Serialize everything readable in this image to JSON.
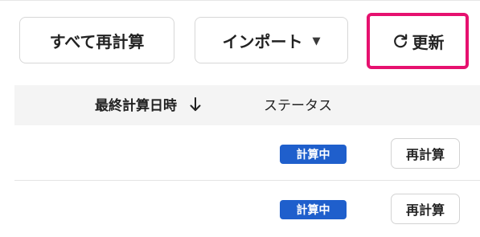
{
  "toolbar": {
    "recalc_all_label": "すべて再計算",
    "import_label": "インポート",
    "refresh_label": "更新",
    "highlight_color": "#e6116f"
  },
  "table": {
    "columns": {
      "last_calculated": "最終計算日時",
      "status": "ステータス"
    },
    "rows": [
      {
        "status": "計算中",
        "action": "再計算"
      },
      {
        "status": "計算中",
        "action": "再計算"
      }
    ]
  },
  "colors": {
    "badge_background": "#1f5fcc"
  },
  "icons": {
    "refresh": "refresh-icon",
    "import_caret": "caret-down-icon",
    "sort": "arrow-down-icon"
  }
}
